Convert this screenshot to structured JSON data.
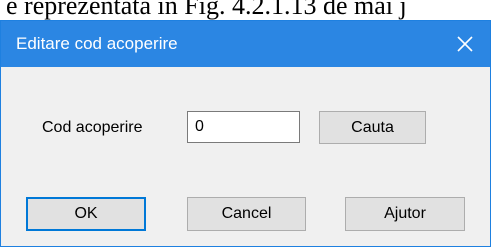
{
  "background": {
    "partial_text": "e reprezentată în Fig. 4.2.1.13 de mai j"
  },
  "dialog": {
    "title": "Editare cod acoperire",
    "close_glyph": "✕",
    "field": {
      "label": "Cod acoperire",
      "value": "0",
      "search_label": "Cauta"
    },
    "buttons": {
      "ok": "OK",
      "cancel": "Cancel",
      "help": "Ajutor"
    }
  },
  "colors": {
    "titlebar": "#2b86e3",
    "body": "#f0f0f0",
    "button": "#e1e1e1",
    "focus_border": "#0078d7"
  },
  "icons": {
    "close": "close-icon"
  }
}
